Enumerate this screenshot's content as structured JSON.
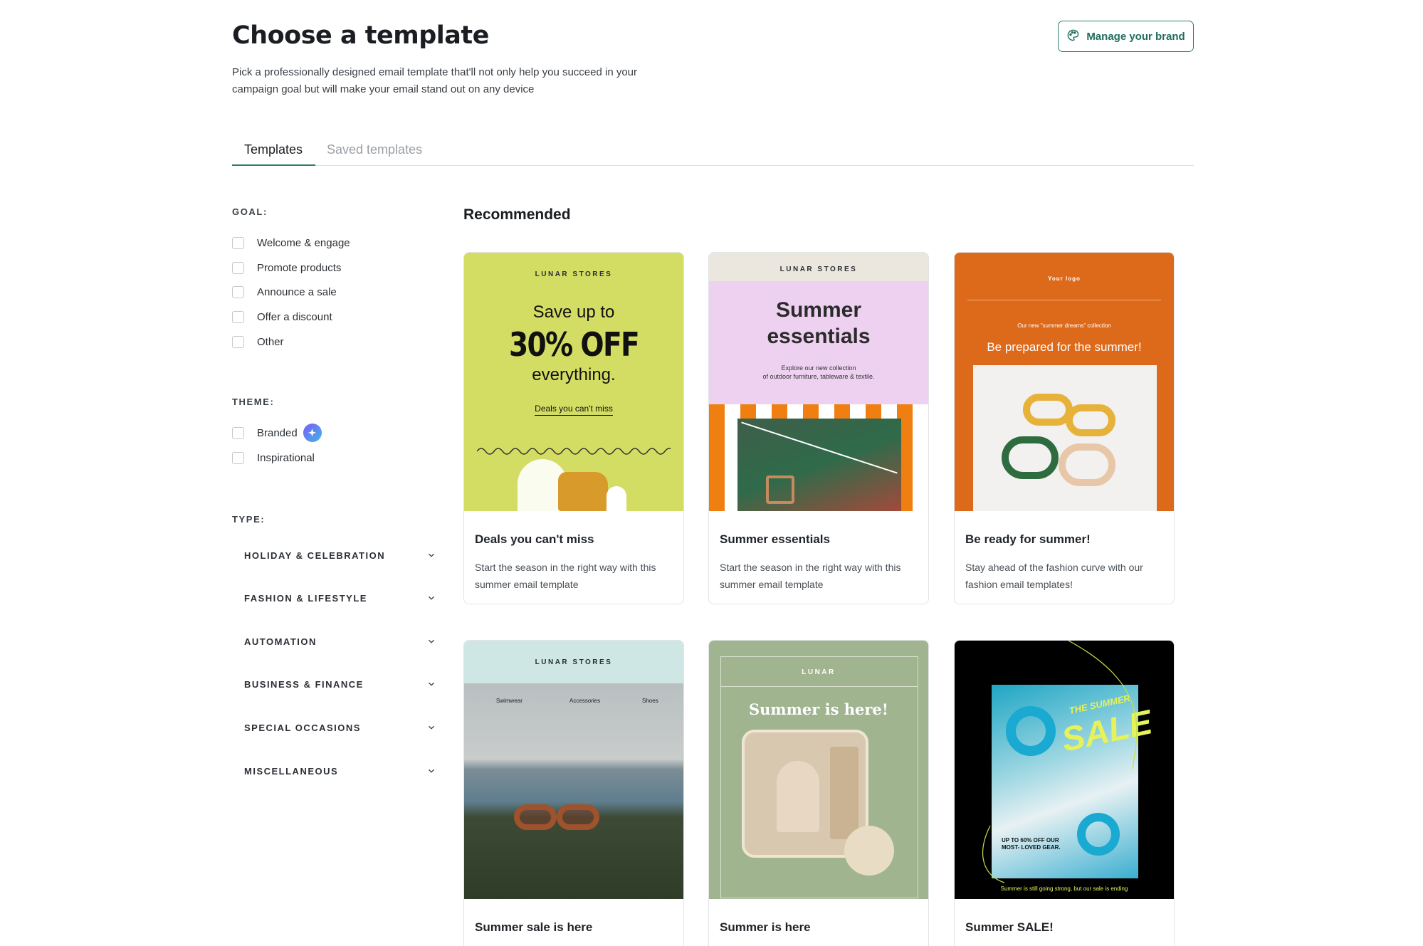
{
  "header": {
    "title": "Choose a template",
    "subtitle": "Pick a professionally designed email template that'll not only help you succeed in your campaign goal but will make your email stand out on any device",
    "brand_button": "Manage your brand"
  },
  "tabs": [
    {
      "label": "Templates",
      "active": true
    },
    {
      "label": "Saved templates",
      "active": false
    }
  ],
  "filters": {
    "goal_label": "GOAL:",
    "goals": [
      "Welcome & engage",
      "Promote products",
      "Announce a sale",
      "Offer a discount",
      "Other"
    ],
    "theme_label": "THEME:",
    "themes": [
      "Branded",
      "Inspirational"
    ],
    "type_label": "TYPE:",
    "types": [
      "HOLIDAY & CELEBRATION",
      "FASHION & LIFESTYLE",
      "AUTOMATION",
      "BUSINESS & FINANCE",
      "SPECIAL OCCASIONS",
      "MISCELLANEOUS"
    ]
  },
  "recommended": {
    "title": "Recommended",
    "cards": [
      {
        "title": "Deals you can't miss",
        "desc": "Start the season in the right way with this summer email template",
        "thumb": {
          "brand": "LUNAR STORES",
          "line1": "Save up to",
          "big": "30% OFF",
          "line2": "everything.",
          "link": "Deals you can't miss"
        }
      },
      {
        "title": "Summer essentials",
        "desc": "Start the season in the right way with this summer email template",
        "thumb": {
          "brand": "LUNAR STORES",
          "headline1": "Summer",
          "headline2": "essentials",
          "sub1": "Explore our new collection",
          "sub2": "of outdoor furniture, tableware & textile."
        }
      },
      {
        "title": "Be ready for summer!",
        "desc": "Stay ahead of the fashion curve with our fashion email templates!",
        "thumb": {
          "logo": "Your logo",
          "eyebrow": "Our new \"summer dreams\" collection",
          "headline": "Be prepared for the summer!"
        }
      },
      {
        "title": "Summer sale is here",
        "desc": "",
        "thumb": {
          "brand": "LUNAR STORES",
          "nav": [
            "Swimwear",
            "Accessories",
            "Shoes"
          ]
        }
      },
      {
        "title": "Summer is here",
        "desc": "",
        "thumb": {
          "brand": "LUNAR",
          "headline": "Summer is here!"
        }
      },
      {
        "title": "Summer SALE!",
        "desc": "",
        "thumb": {
          "script1": "THE SUMMER",
          "script2": "SALE",
          "promo": "UP TO 60% OFF OUR MOST- LOVED GEAR.",
          "footer": "Summer is still going strong, but our sale is ending"
        }
      }
    ]
  },
  "colors": {
    "accent": "#2f7d6d",
    "card1_bg": "#d4dd63",
    "card2_bg": "#eed1f0",
    "card3_bg": "#dd6a1a",
    "card4_bg": "#cfe7e4",
    "card5_bg": "#9fb48f",
    "card6_bg": "#000000"
  },
  "icons": {
    "brand_button": "palette-icon",
    "branded_badge": "sparkle-icon",
    "type_chevron": "chevron-down-icon"
  }
}
